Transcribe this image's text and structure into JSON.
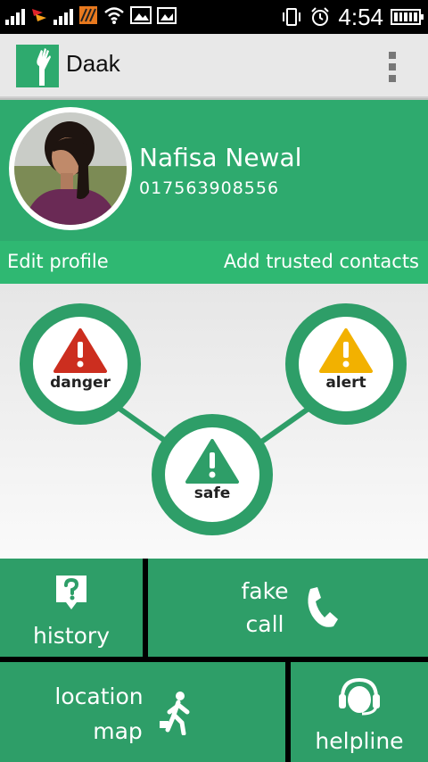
{
  "status_bar": {
    "time": "4:54",
    "icons": [
      "signal-icon",
      "network-activity-icon",
      "signal-icon",
      "notification-icon",
      "wifi-icon",
      "image-icon",
      "gallery-icon",
      "vibrate-icon",
      "alarm-icon",
      "battery-icon"
    ]
  },
  "app": {
    "title": "Daak",
    "menu_icon": "overflow-menu-icon"
  },
  "profile": {
    "name": "Nafisa Newal",
    "phone": "017563908556"
  },
  "links": {
    "edit_profile": "Edit profile",
    "add_trusted_contacts": "Add trusted contacts"
  },
  "status_buttons": {
    "danger": {
      "label": "danger",
      "color": "#cc2e1f",
      "icon": "warning-icon"
    },
    "alert": {
      "label": "alert",
      "color": "#f2b100",
      "icon": "warning-icon"
    },
    "safe": {
      "label": "safe",
      "color": "#2e9e68",
      "icon": "warning-icon"
    }
  },
  "tiles": {
    "history": {
      "label": "history",
      "icon": "question-bubble-icon"
    },
    "fake_call": {
      "line1": "fake",
      "line2": "call",
      "icon": "phone-icon"
    },
    "location_map": {
      "line1": "location",
      "line2": "map",
      "icon": "walking-person-icon"
    },
    "helpline": {
      "label": "helpline",
      "icon": "headset-icon"
    }
  },
  "colors": {
    "primary": "#2e9e68",
    "header_green": "#2eaa6e",
    "links_bar": "#2fb872"
  }
}
